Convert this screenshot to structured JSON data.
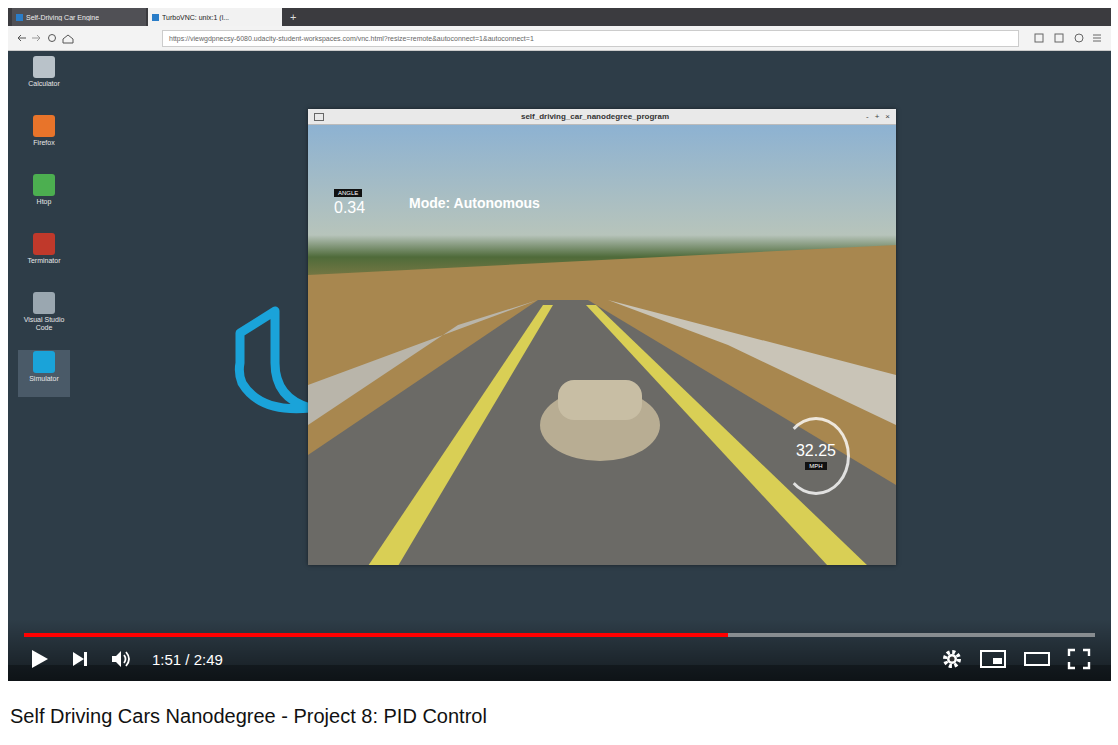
{
  "browser": {
    "tabs": [
      {
        "label": "Self-Driving Car Engine",
        "selected": false
      },
      {
        "label": "TurboVNC: unix:1 (l...",
        "selected": true
      }
    ],
    "new_tab": "+",
    "url": "https://viewgdpnecsy-6080.udacity-student-workspaces.com/vnc.html?resize=remote&autoconnect=1&autoconnect=1"
  },
  "desktop": {
    "icons": [
      {
        "label": "Calculator",
        "selected": false
      },
      {
        "label": "Firefox",
        "selected": false
      },
      {
        "label": "Htop",
        "selected": false
      },
      {
        "label": "Terminator",
        "selected": false
      },
      {
        "label": "Visual Studio Code",
        "selected": false
      },
      {
        "label": "Simulator",
        "selected": true
      }
    ]
  },
  "sim_window": {
    "title": "self_driving_car_nanodegree_program",
    "buttons": [
      "-",
      "+",
      "×"
    ]
  },
  "hud": {
    "angle_label": "ANGLE",
    "angle": "0.34",
    "mode": "Mode: Autonomous",
    "speed": "32.25",
    "unit": "MPH"
  },
  "player": {
    "time": "1:51 / 2:49",
    "progress": 0.657,
    "paused": true
  },
  "video_title": "Self Driving Cars Nanodegree - Project 8: PID Control"
}
